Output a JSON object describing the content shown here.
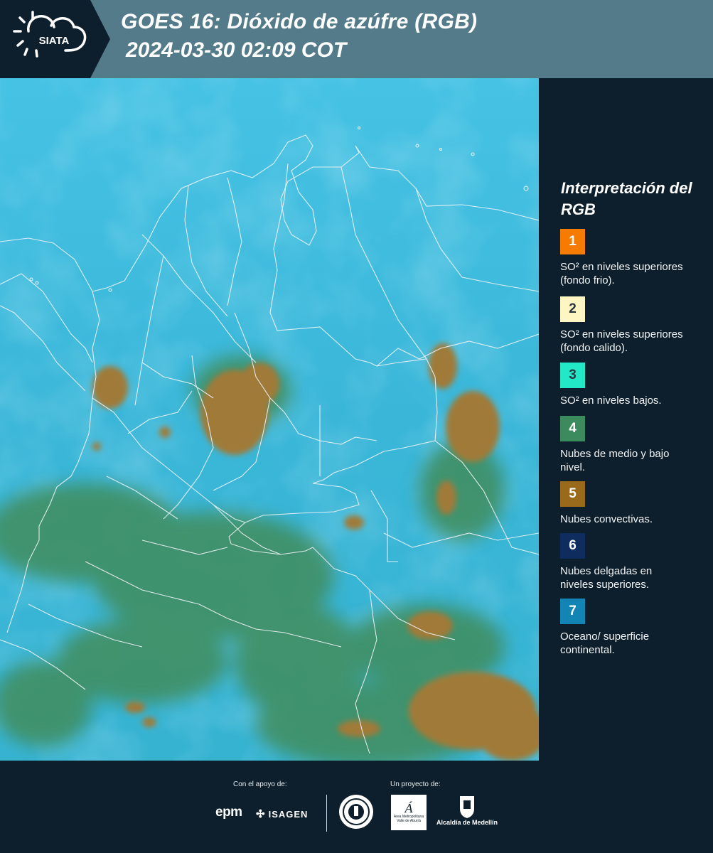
{
  "header": {
    "logo_text": "SIATA",
    "title_line1": "GOES 16: Dióxido de azúfre (RGB)",
    "title_line2": "2024-03-30 02:09 COT"
  },
  "colors": {
    "header_bg": "#537b8a",
    "panel_bg": "#0d1f2c",
    "ocean_cyan": "#3cbde0",
    "low_cloud_green": "#3b8f5a",
    "convective_brown": "#9a7a37"
  },
  "legend": {
    "title": "Interpretación del RGB",
    "items": [
      {
        "number": "1",
        "color": "#f57c00",
        "text": "SO² en niveles superiores (fondo frio)."
      },
      {
        "number": "2",
        "color": "#fdf6c3",
        "text": "SO² en niveles superiores (fondo calido)."
      },
      {
        "number": "3",
        "color": "#22e8c8",
        "text": "SO² en niveles bajos."
      },
      {
        "number": "4",
        "color": "#3b8b5e",
        "text": "Nubes de medio y bajo nivel."
      },
      {
        "number": "5",
        "color": "#9a6a1c",
        "text": "Nubes convectivas."
      },
      {
        "number": "6",
        "color": "#0e2d5e",
        "text": "Nubes delgadas en niveles superiores."
      },
      {
        "number": "7",
        "color": "#1385b5",
        "text": "Oceano/ superficie continental."
      }
    ]
  },
  "footer": {
    "support_caption": "Con el apoyo de:",
    "project_caption": "Un proyecto de:",
    "logos": [
      "epm",
      "ISAGEN",
      "Área Metropolitana Valle de Aburrá",
      "Alcaldía de Medellín"
    ]
  }
}
